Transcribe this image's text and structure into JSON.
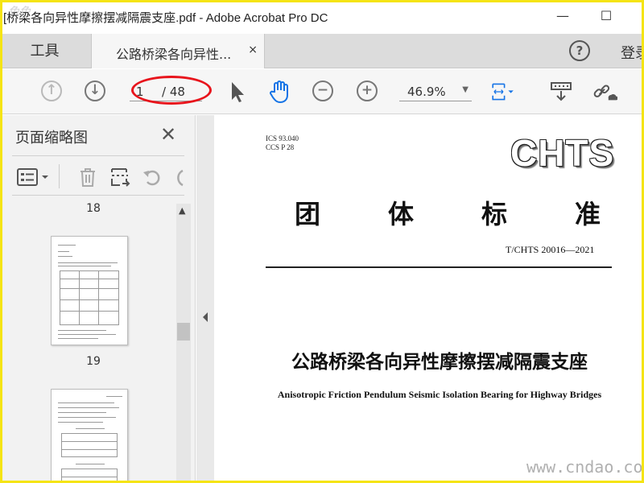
{
  "window": {
    "title": "[桥梁各向异性摩擦摆减隔震支座.pdf - Adobe Acrobat Pro DC",
    "minimize_glyph": "—",
    "maximize_glyph": "☐",
    "watermark": "兔兔"
  },
  "tabs": {
    "tools_label": "工具",
    "doc_label": "公路桥梁各向异性...",
    "close_glyph": "×",
    "help_glyph": "?",
    "login_label": "登录"
  },
  "toolbar": {
    "page_current": "1",
    "page_total": "/ 48",
    "zoom": "46.9%",
    "zoom_caret": "▼",
    "prev_glyph": "↑",
    "next_glyph": "↓",
    "zoom_out_glyph": "−",
    "zoom_in_glyph": "+",
    "highlight_color": "#e8141c",
    "accent_color": "#1473e6"
  },
  "left_panel": {
    "title": "页面缩略图",
    "close_glyph": "✕",
    "page_labels": [
      "18",
      "19"
    ],
    "scroll_up_glyph": "▲"
  },
  "document": {
    "ics": "ICS 93.040",
    "ccs": "CCS P 28",
    "logo": "CHTS",
    "heading_chars": [
      "团",
      "体",
      "标",
      "准"
    ],
    "standard_no": "T/CHTS 20016—2021",
    "title_cn": "公路桥梁各向异性摩擦摆减隔震支座",
    "title_en": "Anisotropic Friction Pendulum Seismic Isolation Bearing for Highway Bridges"
  },
  "watermark_br": "www.cndao.com"
}
